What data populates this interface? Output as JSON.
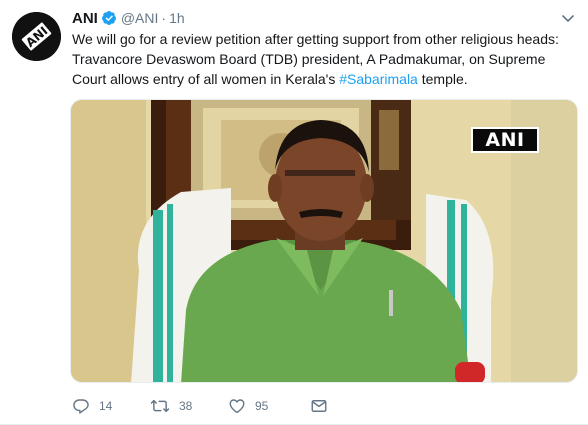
{
  "tweet": {
    "author_name": "ANI",
    "author_handle": "@ANI",
    "separator": "·",
    "time": "1h",
    "text_before": "We will go for a review petition after getting support from other religious heads: Travancore Devaswom Board (TDB) president, A Padmakumar, on Supreme Court allows entry of all women in Kerala's ",
    "hashtag": "#Sabarimala",
    "text_after": " temple.",
    "avatar_logo_text": "ANI",
    "media_watermark": "ANI"
  },
  "actions": {
    "reply_count": "14",
    "retweet_count": "38",
    "like_count": "95"
  },
  "icons": {
    "verified": "verified-badge-icon",
    "reply": "reply-icon",
    "retweet": "retweet-icon",
    "like": "heart-icon",
    "message": "direct-message-icon",
    "more": "chevron-down-icon"
  },
  "colors": {
    "link": "#1da1f2",
    "secondary_text": "#657786",
    "verified": "#1da1f2"
  }
}
